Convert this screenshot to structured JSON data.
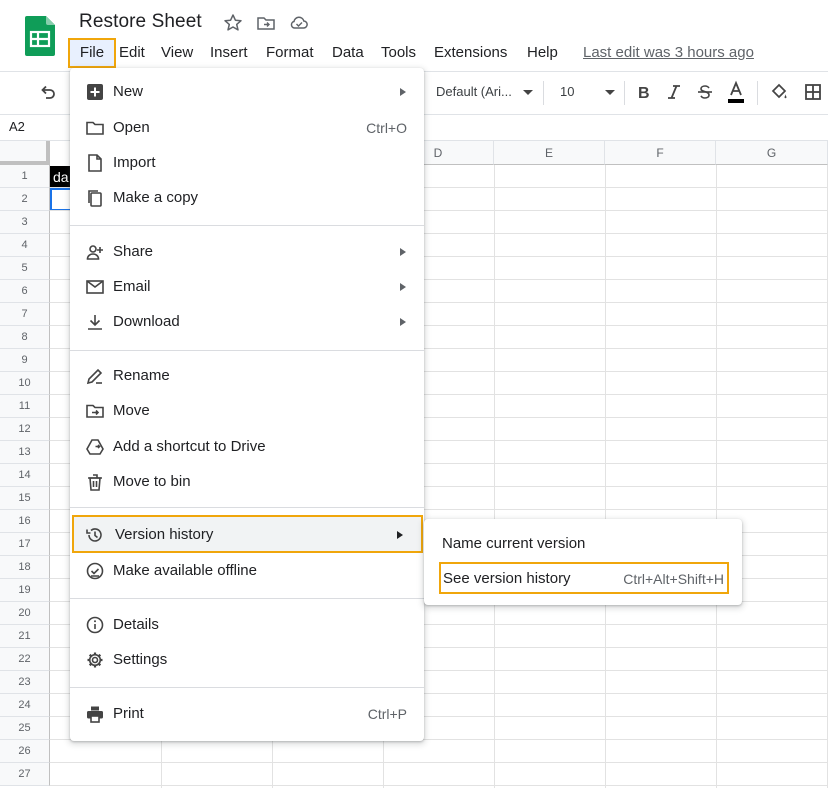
{
  "header": {
    "title": "Restore Sheet",
    "menus": [
      "File",
      "Edit",
      "View",
      "Insert",
      "Format",
      "Data",
      "Tools",
      "Extensions",
      "Help"
    ],
    "last_edit": "Last edit was 3 hours ago"
  },
  "toolbar": {
    "font": "Default (Ari...",
    "font_size": "10"
  },
  "namebox": "A2",
  "grid": {
    "columns": [
      "D",
      "E",
      "F",
      "G"
    ],
    "rows": [
      "1",
      "2",
      "3",
      "4",
      "5",
      "6",
      "7",
      "8",
      "9",
      "10",
      "11",
      "12",
      "13",
      "14",
      "15",
      "16",
      "17",
      "18",
      "19",
      "20",
      "21",
      "22",
      "23",
      "24",
      "25",
      "26",
      "27"
    ],
    "cell_a1": "da"
  },
  "file_menu": {
    "items": [
      {
        "label": "New",
        "icon": "plus-icon",
        "submenu": true
      },
      {
        "label": "Open",
        "icon": "folder-icon",
        "shortcut": "Ctrl+O"
      },
      {
        "label": "Import",
        "icon": "file-icon"
      },
      {
        "label": "Make a copy",
        "icon": "copy-icon"
      },
      {
        "label": "Share",
        "icon": "person-add-icon",
        "submenu": true
      },
      {
        "label": "Email",
        "icon": "mail-icon",
        "submenu": true
      },
      {
        "label": "Download",
        "icon": "download-icon",
        "submenu": true
      },
      {
        "label": "Rename",
        "icon": "rename-icon"
      },
      {
        "label": "Move",
        "icon": "folder-move-icon"
      },
      {
        "label": "Add a shortcut to Drive",
        "icon": "drive-shortcut-icon"
      },
      {
        "label": "Move to bin",
        "icon": "trash-icon"
      },
      {
        "label": "Version history",
        "icon": "history-icon",
        "submenu": true
      },
      {
        "label": "Make available offline",
        "icon": "offline-icon"
      },
      {
        "label": "Details",
        "icon": "info-icon"
      },
      {
        "label": "Settings",
        "icon": "gear-icon"
      },
      {
        "label": "Print",
        "icon": "print-icon",
        "shortcut": "Ctrl+P"
      }
    ]
  },
  "version_submenu": {
    "items": [
      {
        "label": "Name current version"
      },
      {
        "label": "See version history",
        "shortcut": "Ctrl+Alt+Shift+H"
      }
    ]
  },
  "colors": {
    "highlight_border": "#f0a60b",
    "sheets_green": "#0f9d58",
    "selection_blue": "#1a73e8"
  }
}
